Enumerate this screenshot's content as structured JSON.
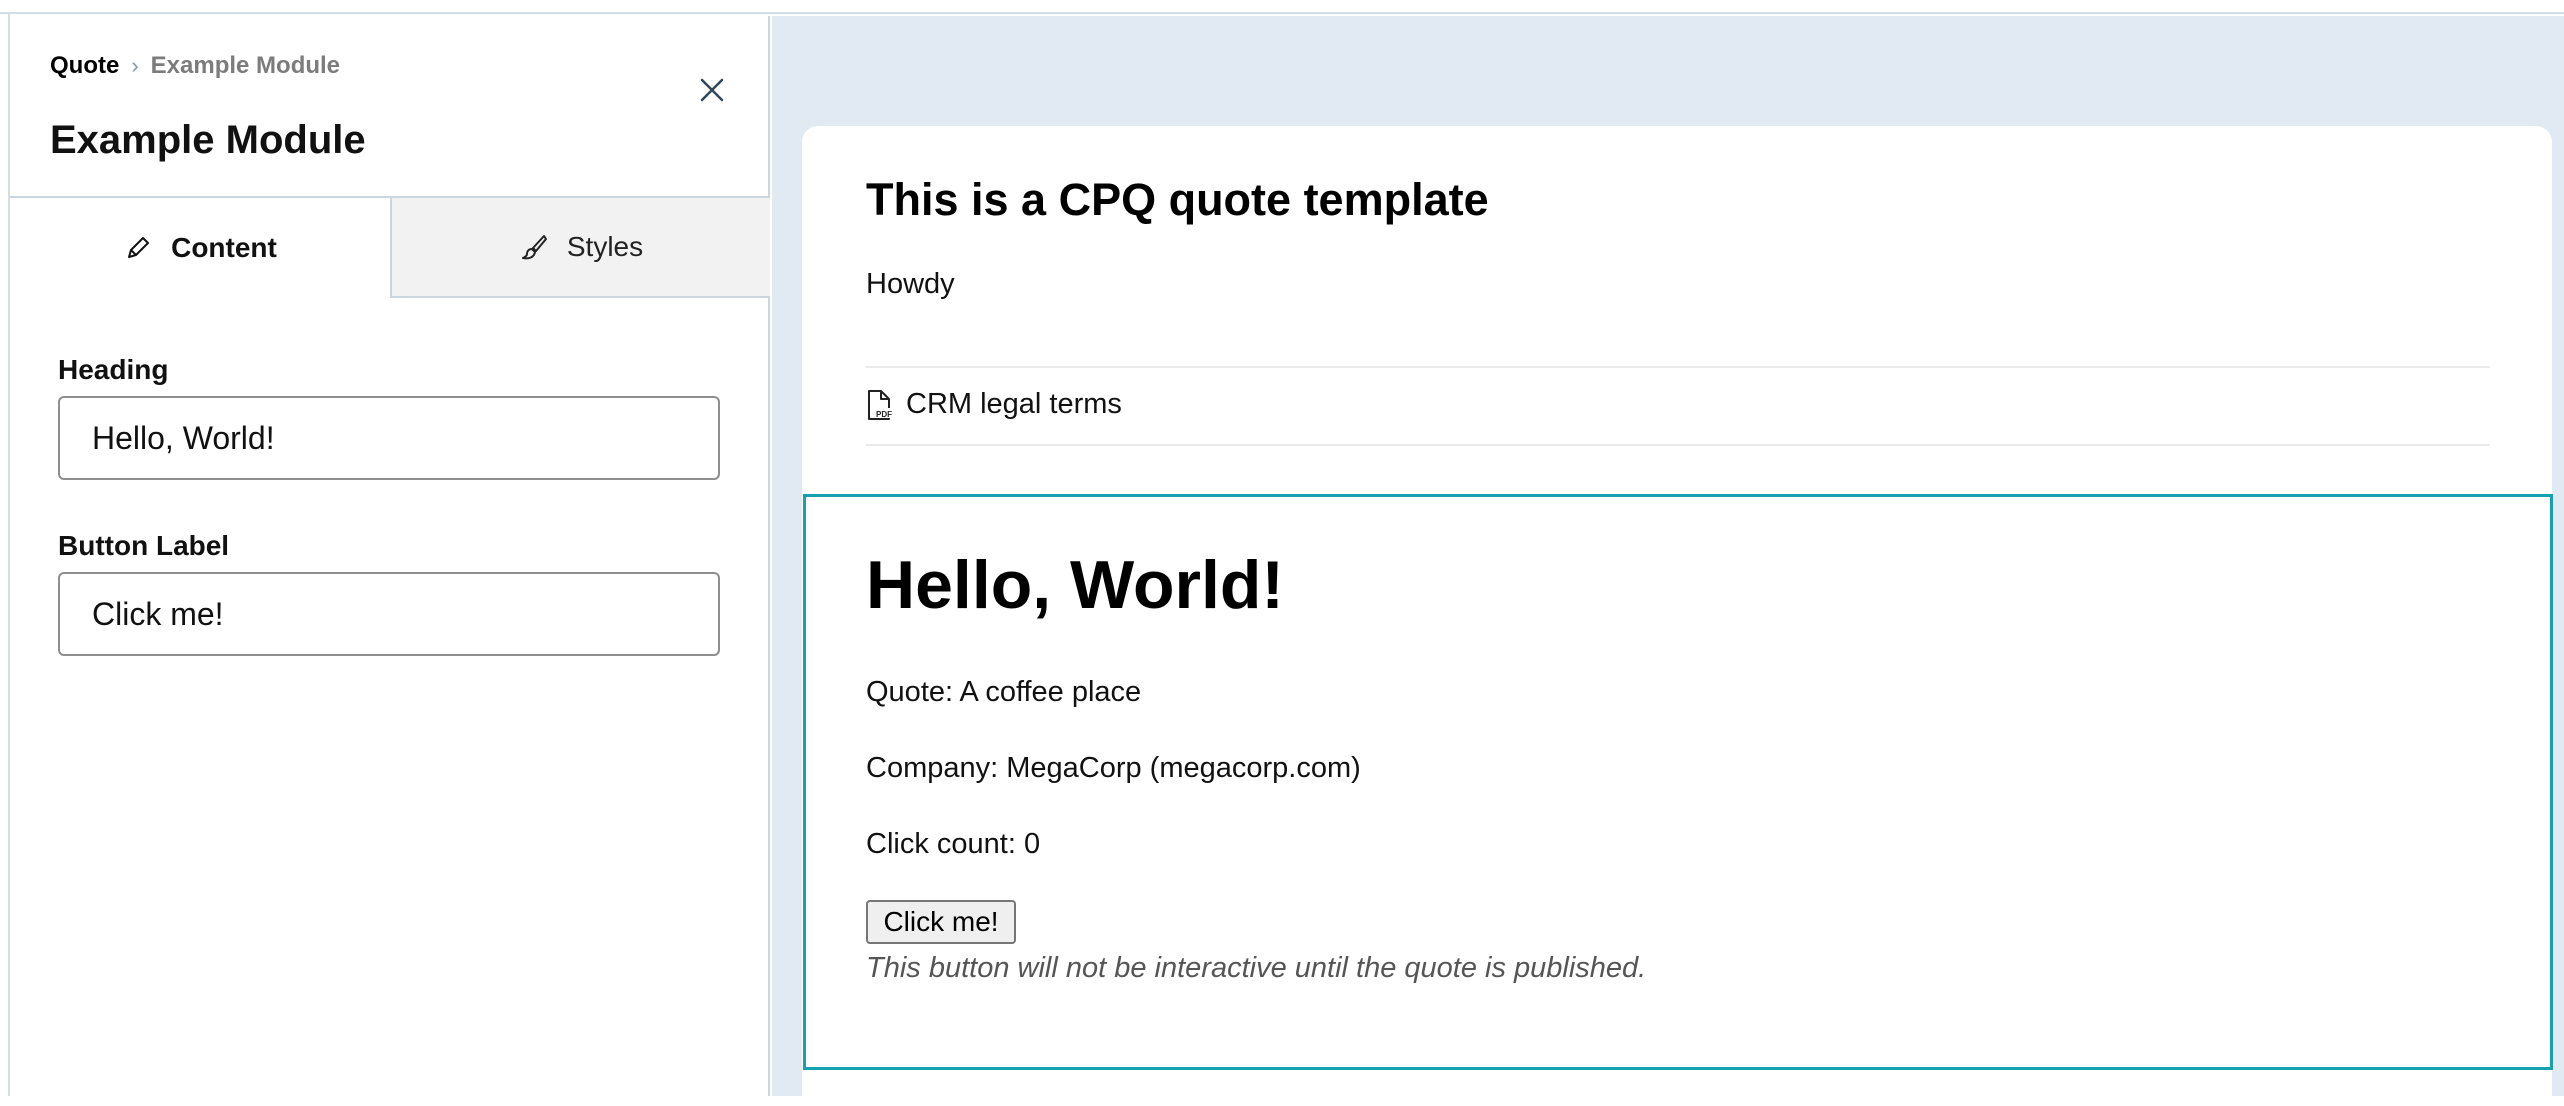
{
  "editor": {
    "breadcrumb": {
      "root": "Quote",
      "separator": "›",
      "current": "Example Module"
    },
    "title": "Example Module",
    "close_icon": "close-icon",
    "tabs": [
      {
        "label": "Content",
        "icon": "pencil-icon",
        "active": true
      },
      {
        "label": "Styles",
        "icon": "paintbrush-icon",
        "active": false
      }
    ],
    "fields": [
      {
        "label": "Heading",
        "value": "Hello, World!"
      },
      {
        "label": "Button Label",
        "value": "Click me!"
      }
    ]
  },
  "preview": {
    "template_title": "This is a CPQ quote template",
    "greeting": "Howdy",
    "legal": {
      "icon": "pdf-file-icon",
      "label": "CRM legal terms"
    },
    "module": {
      "heading": "Hello, World!",
      "quote_line": "Quote: A coffee place",
      "company_line": "Company: MegaCorp (megacorp.com)",
      "click_count_line": "Click count: 0",
      "button_label": "Click me!",
      "note": "This button will not be interactive until the quote is published."
    }
  },
  "colors": {
    "preview_background": "#e1e9f2",
    "module_highlight": "#17a0b0",
    "panel_border": "#cbd6e2"
  }
}
